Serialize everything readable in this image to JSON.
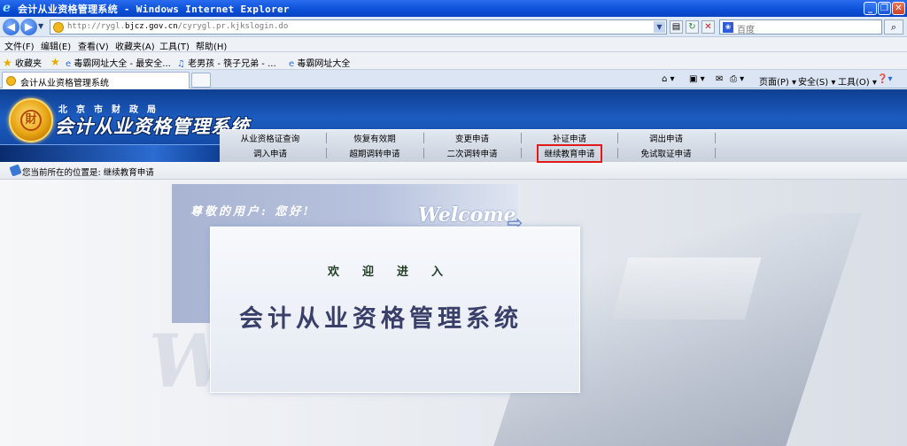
{
  "window": {
    "title": "会计从业资格管理系统 - Windows Internet Explorer",
    "buttons": [
      "_",
      "❐",
      "✕"
    ]
  },
  "address": {
    "url_prefix": "http://rygl.",
    "url_host": "bjcz.gov.cn",
    "url_path": "/cyrygl.pr.kjkslogin.do",
    "search_placeholder": "百度"
  },
  "menu": [
    "文件(F)",
    "编辑(E)",
    "查看(V)",
    "收藏夹(A)",
    "工具(T)",
    "帮助(H)"
  ],
  "favorites": {
    "label": "收藏夹",
    "items": [
      "毒霸网址大全 - 最安全...",
      "老男孩 - 筷子兄弟 - ...",
      "毒霸网址大全"
    ]
  },
  "tabs": [
    {
      "label": "会计从业资格管理系统"
    }
  ],
  "commands": {
    "page": "页面(P)",
    "safety": "安全(S)",
    "tools": "工具(O)"
  },
  "header": {
    "emblem_glyph": "財",
    "org": "北京市财政局",
    "system_name": "会计从业资格管理系统"
  },
  "nav": {
    "row1": [
      "从业资格证查询",
      "恢复有效期",
      "变更申请",
      "补证申请",
      "调出申请"
    ],
    "row2": [
      "调入申请",
      "超期调转申请",
      "二次调转申请",
      "继续教育申请",
      "免试取证申请"
    ],
    "highlighted": "继续教育申请"
  },
  "breadcrumb": "您当前所在的位置是: 继续教育申请",
  "welcome": {
    "greeting": "尊敬的用户: 您好!",
    "welcome_small": "Welcome",
    "enter": "欢迎进入",
    "title": "会计从业资格管理系统",
    "welcome_big": "Welcome"
  },
  "colors": {
    "highlight": "#e21a1a",
    "header_blue": "#1c5cc0"
  }
}
